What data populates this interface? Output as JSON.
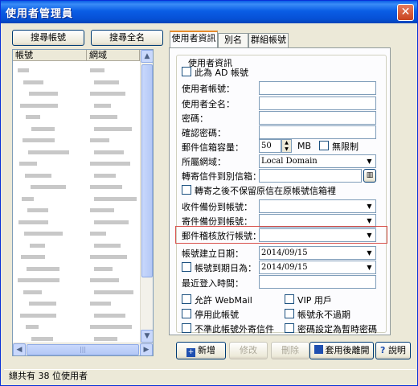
{
  "window": {
    "title": "使用者管理員",
    "close": "✕"
  },
  "left": {
    "search_account": "搜尋帳號",
    "search_fullname": "搜尋全名",
    "col_account": "帳號",
    "col_domain": "網域"
  },
  "tabs": [
    "使用者資訊",
    "別名",
    "群組帳號"
  ],
  "form": {
    "group_title": "使用者資訊",
    "ad_account": "此為 AD 帳號",
    "account_label": "使用者帳號：",
    "fullname_label": "使用者全名：",
    "password_label": "密碼：",
    "confirm_label": "確認密碼：",
    "mailbox_label": "郵件信箱容量：",
    "mailbox_value": "50",
    "mailbox_unit": "MB",
    "unlimited": "無限制",
    "domain_label": "所屬網域：",
    "domain_value": "Local Domain",
    "forward_label": "轉寄信件到別信箱：",
    "no_keep": "轉寄之後不保留原信在原帳號信箱裡",
    "recv_backup_label": "收件備份到帳號：",
    "send_backup_label": "寄件備份到帳號：",
    "audit_label": "郵件稽核放行帳號：",
    "created_label": "帳號建立日期：",
    "created_value": "2014/09/15",
    "expire_label": "帳號到期日為：",
    "expire_value": "2014/09/15",
    "lastlogin_label": "最近登入時間：",
    "allow_webmail": "允許 WebMail",
    "vip": "VIP 用戶",
    "disable_account": "停用此帳號",
    "never_expire": "帳號永不過期",
    "no_external": "不準此帳號外寄信件",
    "temp_password": "密碼設定為暫時密碼"
  },
  "buttons": {
    "add": "新增",
    "edit": "修改",
    "delete": "刪除",
    "apply_close": "套用後離開",
    "help": "說明"
  },
  "status": "總共有 38 位使用者"
}
